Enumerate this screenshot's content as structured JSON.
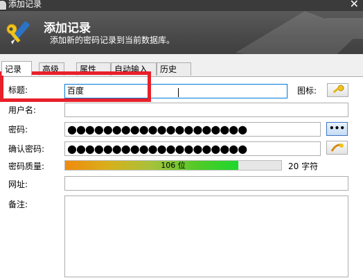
{
  "window": {
    "title": "添加记录",
    "close_glyph": "✕"
  },
  "banner": {
    "title": "添加记录",
    "subtitle": "添加新的密码记录到当前数据库。"
  },
  "tabs": [
    {
      "label": "记录",
      "active": true
    },
    {
      "label": "高级",
      "active": false
    },
    {
      "label": "属性",
      "active": false
    },
    {
      "label": "自动输入",
      "active": false
    },
    {
      "label": "历史",
      "active": false
    }
  ],
  "form": {
    "title": {
      "label": "标题:",
      "value": "百度"
    },
    "icon_label": "图标:",
    "username": {
      "label": "用户名:",
      "value": ""
    },
    "password": {
      "label": "密码:",
      "value": "●●●●●●●●●●●●●●●●●●●●"
    },
    "repeat": {
      "label": "确认密码:",
      "value": "●●●●●●●●●●●●●●●●●●●●"
    },
    "quality": {
      "label": "密码质量:",
      "bits_text": "106 位",
      "fraction": 0.8,
      "chars_text": "20 字符"
    },
    "url": {
      "label": "网址:",
      "value": ""
    },
    "notes": {
      "label": "备注:",
      "value": ""
    },
    "show_password_button": "•••"
  },
  "icons": {
    "app": "lock-icon",
    "banner": "key-pen-icon",
    "record_icon": "key-icon",
    "generator": "password-generator-icon"
  },
  "colors": {
    "highlight": "#e8202a",
    "focus": "#0078d7",
    "quality_low": "#f08a0e",
    "quality_high": "#1cd82c"
  }
}
